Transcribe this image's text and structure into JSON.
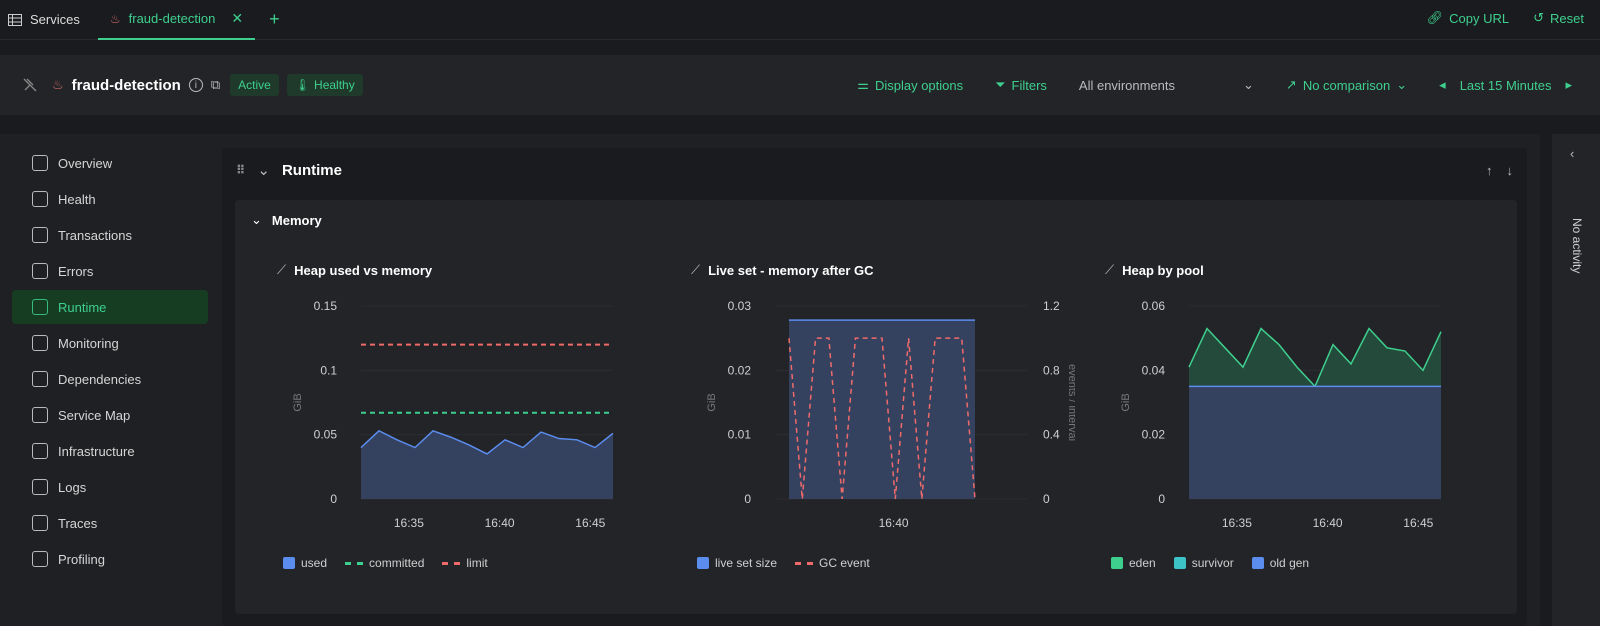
{
  "topbar": {
    "services_label": "Services",
    "tab_label": "fraud-detection",
    "copy_url_label": "Copy URL",
    "reset_label": "Reset"
  },
  "header": {
    "service_name": "fraud-detection",
    "status_badge": "Active",
    "health_badge": "Healthy",
    "display_options": "Display options",
    "filters": "Filters",
    "environment": "All environments",
    "comparison": "No comparison",
    "time_range": "Last 15 Minutes"
  },
  "sidebar": {
    "items": [
      {
        "label": "Overview",
        "icon": "overview-icon"
      },
      {
        "label": "Health",
        "icon": "thermometer-icon"
      },
      {
        "label": "Transactions",
        "icon": "broadcast-icon"
      },
      {
        "label": "Errors",
        "icon": "alert-circle-icon"
      },
      {
        "label": "Runtime",
        "icon": "pulse-icon"
      },
      {
        "label": "Monitoring",
        "icon": "bell-icon"
      },
      {
        "label": "Dependencies",
        "icon": "dependencies-icon"
      },
      {
        "label": "Service Map",
        "icon": "service-map-icon"
      },
      {
        "label": "Infrastructure",
        "icon": "server-icon"
      },
      {
        "label": "Logs",
        "icon": "logs-icon"
      },
      {
        "label": "Traces",
        "icon": "traces-icon"
      },
      {
        "label": "Profiling",
        "icon": "profiling-icon"
      }
    ],
    "active_index": 4
  },
  "runtime": {
    "title": "Runtime",
    "memory_title": "Memory"
  },
  "rail": {
    "label": "No activity"
  },
  "colors": {
    "accent": "#3ecf8e",
    "used": "#5b8def",
    "limit": "#ef6b6b"
  },
  "chart_data": [
    {
      "type": "area",
      "title": "Heap used vs memory",
      "ylabel": "GiB",
      "ylim": [
        0,
        0.15
      ],
      "yticks": [
        "0.15",
        "0.1",
        "0.05",
        "0"
      ],
      "xticks": [
        "16:35",
        "16:40",
        "16:45"
      ],
      "series": [
        {
          "name": "used",
          "values": [
            0.04,
            0.053,
            0.046,
            0.04,
            0.053,
            0.048,
            0.042,
            0.035,
            0.046,
            0.04,
            0.052,
            0.047,
            0.046,
            0.04,
            0.051
          ]
        },
        {
          "name": "committed",
          "values": [
            0.067,
            0.067,
            0.067,
            0.067,
            0.067,
            0.067,
            0.067,
            0.067,
            0.067,
            0.067,
            0.067,
            0.067,
            0.067,
            0.067,
            0.067
          ]
        },
        {
          "name": "limit",
          "values": [
            0.12,
            0.12,
            0.12,
            0.12,
            0.12,
            0.12,
            0.12,
            0.12,
            0.12,
            0.12,
            0.12,
            0.12,
            0.12,
            0.12,
            0.12
          ]
        }
      ]
    },
    {
      "type": "area",
      "title": "Live set - memory after GC",
      "ylabel": "GiB",
      "y2label": "events / interval",
      "ylim": [
        0,
        0.03
      ],
      "y2lim": [
        0,
        1.2
      ],
      "yticks": [
        "0.03",
        "0.02",
        "0.01",
        "0"
      ],
      "y2ticks": [
        "1.2",
        "0.8",
        "0.4",
        "0"
      ],
      "xticks": [
        "16:40"
      ],
      "series": [
        {
          "name": "live set size",
          "values": [
            0.0278,
            0.0278,
            0.0278,
            0.0278,
            0.0278,
            0.0278,
            0.0278,
            0.0278,
            0.0278,
            0.0278,
            0.0278,
            0.0278,
            0.0278,
            0.0278,
            0.0278
          ]
        },
        {
          "name": "GC event",
          "values": [
            1,
            0,
            1,
            1,
            0,
            1,
            1,
            1,
            0,
            1,
            0,
            1,
            1,
            1,
            0
          ]
        }
      ]
    },
    {
      "type": "area",
      "title": "Heap by pool",
      "ylabel": "GiB",
      "ylim": [
        0,
        0.06
      ],
      "yticks": [
        "0.06",
        "0.04",
        "0.02",
        "0"
      ],
      "xticks": [
        "16:35",
        "16:40",
        "16:45"
      ],
      "series": [
        {
          "name": "eden",
          "values": [
            0.006,
            0.018,
            0.012,
            0.006,
            0.018,
            0.013,
            0.006,
            0.0,
            0.013,
            0.007,
            0.018,
            0.012,
            0.011,
            0.005,
            0.017
          ]
        },
        {
          "name": "survivor",
          "values": [
            0,
            0,
            0,
            0,
            0,
            0,
            0,
            0,
            0,
            0,
            0,
            0,
            0,
            0,
            0
          ]
        },
        {
          "name": "old gen",
          "values": [
            0.035,
            0.035,
            0.035,
            0.035,
            0.035,
            0.035,
            0.035,
            0.035,
            0.035,
            0.035,
            0.035,
            0.035,
            0.035,
            0.035,
            0.035
          ]
        }
      ]
    }
  ]
}
